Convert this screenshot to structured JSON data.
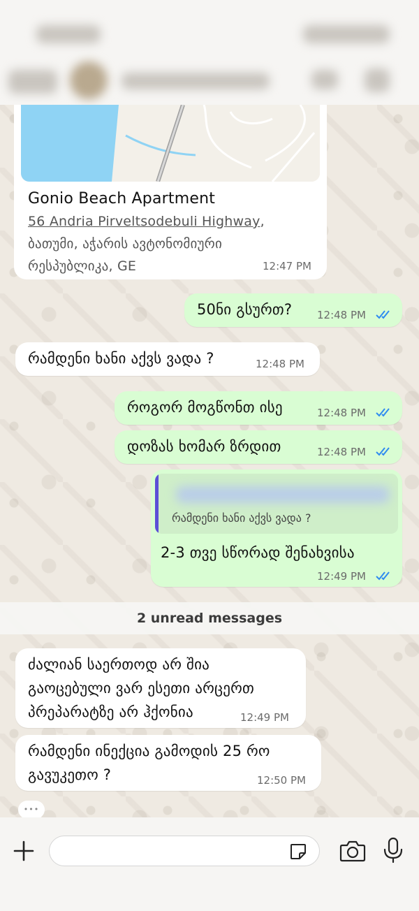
{
  "location": {
    "name": "Gonio Beach Apartment",
    "address_link": "56 Andria Pirveltsodebuli Highway",
    "address_line1_suffix": ",",
    "address_line2": "ბათუმი, აჭარის ავტონომიური",
    "address_line3": "რესპუბლიკა, GE",
    "time": "12:47 PM"
  },
  "messages": [
    {
      "text": "50ნი გსურთ?",
      "time": "12:48 PM"
    },
    {
      "text": "რამდენი ხანი აქვს ვადა ?",
      "time": "12:48 PM"
    },
    {
      "text": "როგორ მოგწონთ ისე",
      "time": "12:48 PM"
    },
    {
      "text": "დოზას ხომარ ზრდით",
      "time": "12:48 PM"
    },
    {
      "reply_quote": "რამდენი ხანი აქვს ვადა ?",
      "text": "2-3 თვე სწორად შენახვისა",
      "time": "12:49 PM"
    },
    {
      "line1": "ძალიან საერთოდ არ შია",
      "line2": "გაოცებული ვარ ესეთი არცერთ",
      "line3": "პრეპარატზე არ ჰქონია",
      "time": "12:49 PM"
    },
    {
      "line1": "რამდენი ინექცია გამოდის 25 რო",
      "line2": "გავუკეთო ?",
      "time": "12:50 PM"
    }
  ],
  "unread": {
    "label": "2 unread messages"
  },
  "typing": {
    "dots": "•••"
  },
  "colors": {
    "outgoing": "#d9fdd3",
    "incoming": "#ffffff",
    "tick": "#2f8bf0",
    "background": "#efeae2"
  },
  "icons": [
    "plus-icon",
    "sticker-icon",
    "camera-icon",
    "microphone-icon",
    "double-check-icon",
    "call-icon",
    "video-icon"
  ]
}
